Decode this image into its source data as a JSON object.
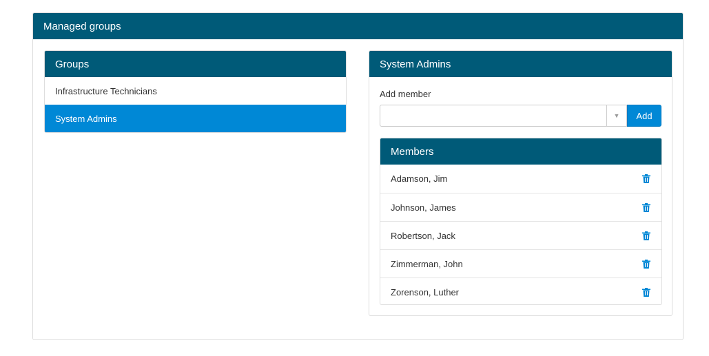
{
  "page": {
    "title": "Managed groups"
  },
  "groups": {
    "title": "Groups",
    "items": [
      {
        "label": "Infrastructure Technicians",
        "active": false
      },
      {
        "label": "System Admins",
        "active": true
      }
    ]
  },
  "detail": {
    "title": "System Admins",
    "add_member_label": "Add member",
    "add_member_value": "",
    "add_button": "Add",
    "members_title": "Members",
    "members": [
      {
        "name": "Adamson, Jim",
        "icon": "trash-icon"
      },
      {
        "name": "Johnson, James",
        "icon": "trash-icon"
      },
      {
        "name": "Robertson, Jack",
        "icon": "trash-icon"
      },
      {
        "name": "Zimmerman, John",
        "icon": "trash-icon"
      },
      {
        "name": "Zorenson, Luther",
        "icon": "trash-icon"
      }
    ]
  },
  "colors": {
    "header": "#005a78",
    "accent": "#0088d6",
    "border": "#dddddd"
  }
}
